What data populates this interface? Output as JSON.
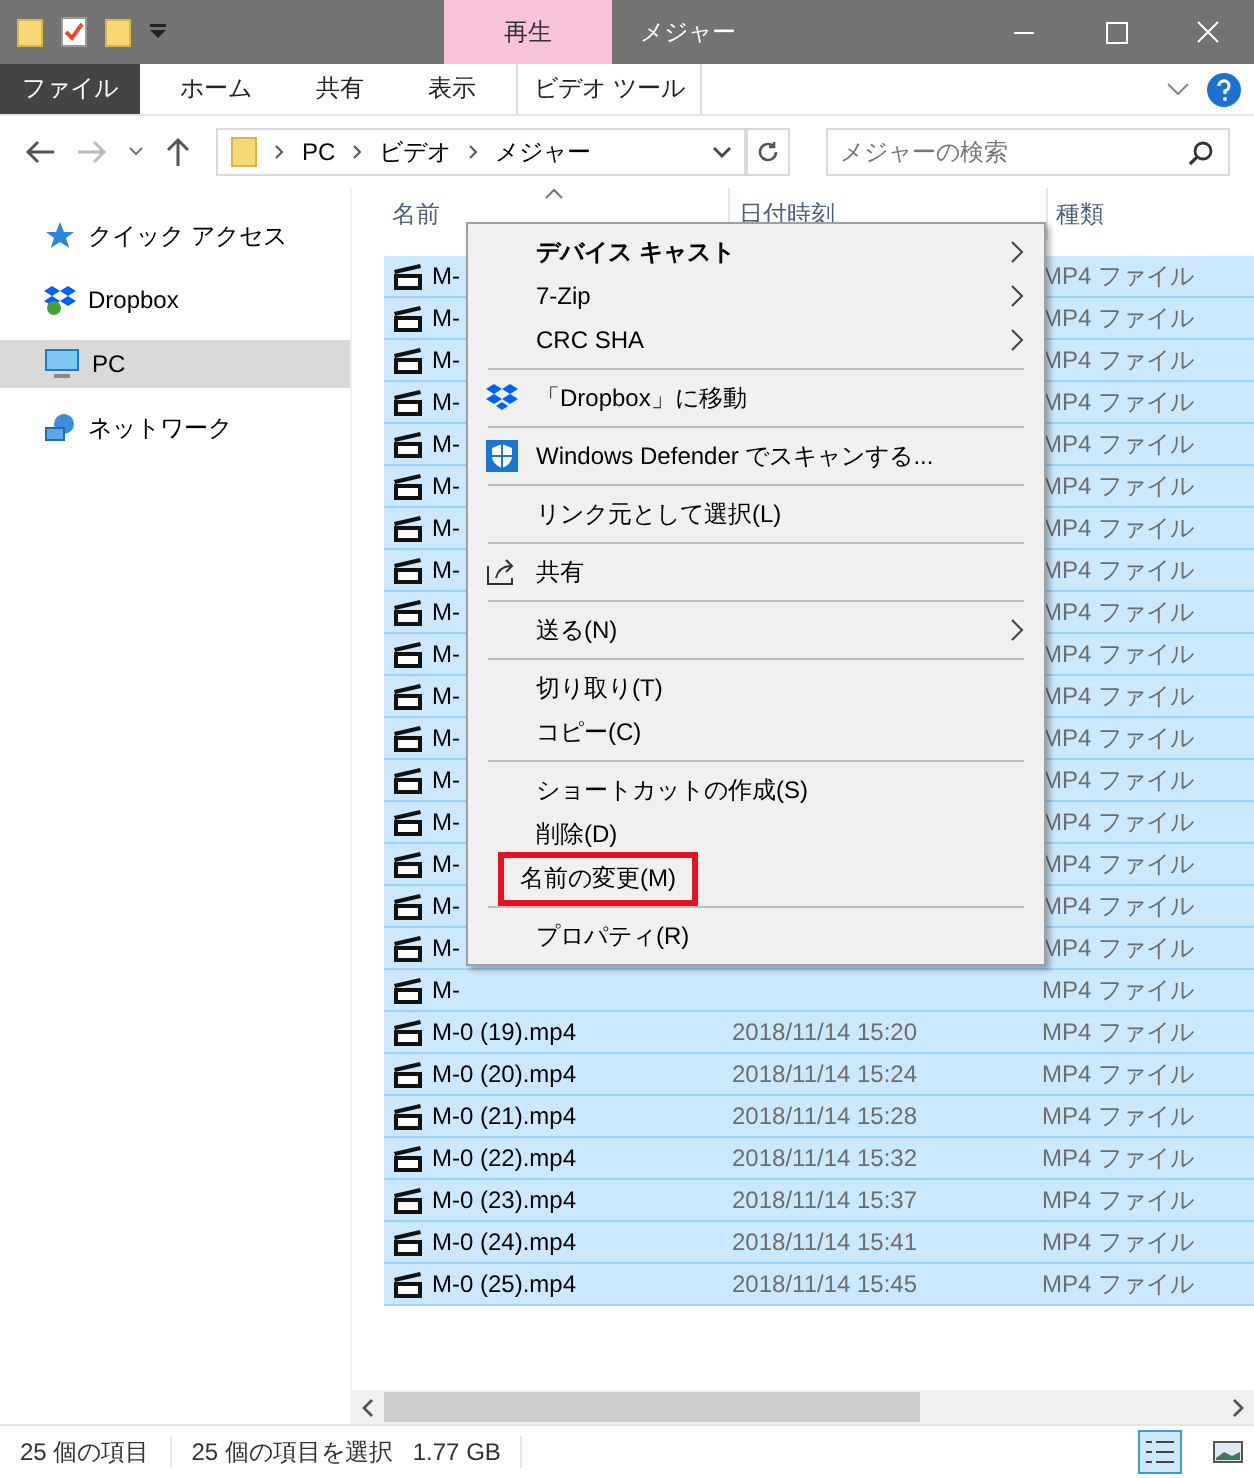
{
  "window": {
    "context_tab": "再生",
    "title": "メジャー"
  },
  "ribbon_tabs": [
    {
      "label": "ファイル",
      "kind": "file",
      "selected": false
    },
    {
      "label": "ホーム",
      "kind": "tab",
      "selected": false
    },
    {
      "label": "共有",
      "kind": "tab",
      "selected": false
    },
    {
      "label": "表示",
      "kind": "tab",
      "selected": false
    },
    {
      "label": "ビデオ ツール",
      "kind": "context",
      "selected": false
    }
  ],
  "address": {
    "path": [
      "PC",
      "ビデオ",
      "メジャー"
    ]
  },
  "search": {
    "placeholder": "メジャーの検索"
  },
  "sidebar": {
    "items": [
      {
        "label": "クイック アクセス",
        "kind": "star",
        "selected": false
      },
      {
        "label": "Dropbox",
        "kind": "dropbox",
        "selected": false
      },
      {
        "label": "PC",
        "kind": "pc",
        "selected": true
      },
      {
        "label": "ネットワーク",
        "kind": "network",
        "selected": false
      }
    ]
  },
  "table": {
    "columns": [
      "名前",
      "日付時刻",
      "種類"
    ],
    "rows": [
      {
        "name": "M-",
        "type": "MP4 ファイル",
        "selected": true
      },
      {
        "name": "M-",
        "type": "MP4 ファイル",
        "selected": true
      },
      {
        "name": "M-",
        "type": "MP4 ファイル",
        "selected": true
      },
      {
        "name": "M-",
        "type": "MP4 ファイル",
        "selected": true
      },
      {
        "name": "M-",
        "type": "MP4 ファイル",
        "selected": true
      },
      {
        "name": "M-",
        "type": "MP4 ファイル",
        "selected": true
      },
      {
        "name": "M-",
        "type": "MP4 ファイル",
        "selected": true
      },
      {
        "name": "M-",
        "type": "MP4 ファイル",
        "selected": true
      },
      {
        "name": "M-",
        "type": "MP4 ファイル",
        "selected": true
      },
      {
        "name": "M-",
        "type": "MP4 ファイル",
        "selected": true
      },
      {
        "name": "M-",
        "type": "MP4 ファイル",
        "selected": true
      },
      {
        "name": "M-",
        "type": "MP4 ファイル",
        "selected": true
      },
      {
        "name": "M-",
        "type": "MP4 ファイル",
        "selected": true
      },
      {
        "name": "M-",
        "type": "MP4 ファイル",
        "selected": true
      },
      {
        "name": "M-",
        "type": "MP4 ファイル",
        "selected": true
      },
      {
        "name": "M-",
        "type": "MP4 ファイル",
        "selected": true
      },
      {
        "name": "M-",
        "type": "MP4 ファイル",
        "selected": true
      },
      {
        "name": "M-",
        "type": "MP4 ファイル",
        "selected": true
      },
      {
        "name": "M-0 (19).mp4",
        "date": "2018/11/14 15:20",
        "type": "MP4 ファイル",
        "selected": true
      },
      {
        "name": "M-0 (20).mp4",
        "date": "2018/11/14 15:24",
        "type": "MP4 ファイル",
        "selected": true
      },
      {
        "name": "M-0 (21).mp4",
        "date": "2018/11/14 15:28",
        "type": "MP4 ファイル",
        "selected": true
      },
      {
        "name": "M-0 (22).mp4",
        "date": "2018/11/14 15:32",
        "type": "MP4 ファイル",
        "selected": true
      },
      {
        "name": "M-0 (23).mp4",
        "date": "2018/11/14 15:37",
        "type": "MP4 ファイル",
        "selected": true
      },
      {
        "name": "M-0 (24).mp4",
        "date": "2018/11/14 15:41",
        "type": "MP4 ファイル",
        "selected": true
      },
      {
        "name": "M-0 (25).mp4",
        "date": "2018/11/14 15:45",
        "type": "MP4 ファイル",
        "selected": true
      }
    ]
  },
  "context_menu": {
    "items": [
      {
        "kind": "submenu",
        "label": "デバイス キャスト",
        "bold": true,
        "highlighted": false
      },
      {
        "kind": "submenu",
        "label": "7-Zip",
        "bold": false,
        "highlighted": false
      },
      {
        "kind": "submenu",
        "label": "CRC SHA",
        "bold": false,
        "highlighted": false
      },
      {
        "kind": "separator"
      },
      {
        "kind": "dropbox",
        "label": "「Dropbox」に移動",
        "bold": false,
        "highlighted": false
      },
      {
        "kind": "separator"
      },
      {
        "kind": "defender",
        "label": "Windows Defender でスキャンする...",
        "bold": false,
        "highlighted": false
      },
      {
        "kind": "separator"
      },
      {
        "kind": "plain",
        "label": "リンク元として選択(L)",
        "bold": false,
        "highlighted": false
      },
      {
        "kind": "separator"
      },
      {
        "kind": "share",
        "label": "共有",
        "bold": false,
        "highlighted": false
      },
      {
        "kind": "separator"
      },
      {
        "kind": "submenu",
        "label": "送る(N)",
        "bold": false,
        "highlighted": false
      },
      {
        "kind": "separator"
      },
      {
        "kind": "plain",
        "label": "切り取り(T)",
        "bold": false,
        "highlighted": false
      },
      {
        "kind": "plain",
        "label": "コピー(C)",
        "bold": false,
        "highlighted": false
      },
      {
        "kind": "separator"
      },
      {
        "kind": "plain",
        "label": "ショートカットの作成(S)",
        "bold": false,
        "highlighted": false
      },
      {
        "kind": "plain",
        "label": "削除(D)",
        "bold": false,
        "highlighted": false
      },
      {
        "kind": "plain",
        "label": "名前の変更(M)",
        "bold": false,
        "highlighted": true
      },
      {
        "kind": "separator"
      },
      {
        "kind": "plain",
        "label": "プロパティ(R)",
        "bold": false,
        "highlighted": false
      }
    ]
  },
  "status_bar": {
    "count": "25 個の項目",
    "selection": "25 個の項目を選択",
    "size": "1.77 GB"
  }
}
